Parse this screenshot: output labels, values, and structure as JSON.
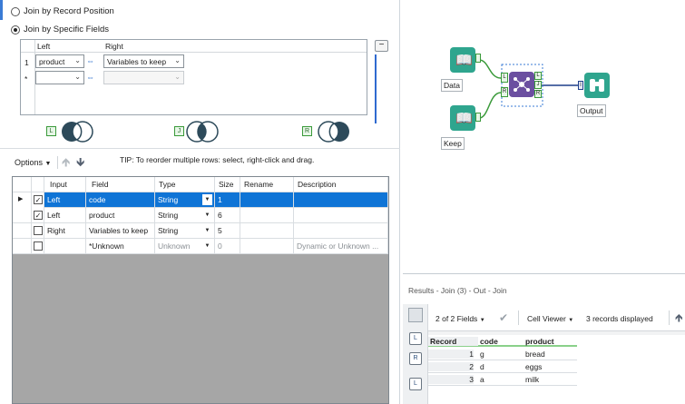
{
  "join_config": {
    "option_record_position": "Join by Record Position",
    "option_specific_fields": "Join by Specific Fields",
    "grid": {
      "header_left": "Left",
      "header_right": "Right",
      "row1_num": "1",
      "row1_left": "product",
      "row1_right": "Variables to keep",
      "row2_num": "*"
    },
    "venn": {
      "left": "L",
      "join": "J",
      "right": "R"
    }
  },
  "options_bar": {
    "options_label": "Options",
    "tip": "TIP: To reorder multiple rows: select, right-click and drag."
  },
  "field_table": {
    "headers": [
      "Input",
      "Field",
      "Type",
      "Size",
      "Rename",
      "Description"
    ],
    "rows": [
      {
        "checked": true,
        "input": "Left",
        "field": "code",
        "type": "String",
        "size": "1",
        "rename": "",
        "description": ""
      },
      {
        "checked": true,
        "input": "Left",
        "field": "product",
        "type": "String",
        "size": "6",
        "rename": "",
        "description": ""
      },
      {
        "checked": false,
        "input": "Right",
        "field": "Variables to keep",
        "type": "String",
        "size": "5",
        "rename": "",
        "description": ""
      },
      {
        "checked": false,
        "input": "",
        "field": "*Unknown",
        "type": "Unknown",
        "size": "0",
        "rename": "",
        "description": "Dynamic or Unknown ..."
      }
    ]
  },
  "canvas": {
    "tools": {
      "data_label": "Data",
      "keep_label": "Keep",
      "output_label": "Output",
      "join_anchors": [
        "L",
        "J",
        "R"
      ],
      "input_anchor_l": "L",
      "input_anchor_r": "R",
      "browse_anchor": "I"
    }
  },
  "results": {
    "title": "Results - Join (3) - Out - Join",
    "fields_selector": "2 of 2 Fields",
    "viewer": "Cell Viewer",
    "records_text": "3 records displayed",
    "side_buttons": [
      "L",
      "R",
      "L"
    ],
    "headers": [
      "Record",
      "code",
      "product"
    ],
    "rows": [
      {
        "record": "1",
        "code": "g",
        "product": "bread"
      },
      {
        "record": "2",
        "code": "d",
        "product": "eggs"
      },
      {
        "record": "3",
        "code": "a",
        "product": "milk"
      }
    ]
  },
  "colors": {
    "accent": "#0f74d6",
    "tool_green": "#2fa58e",
    "join_purple": "#6b4fa0",
    "connector_green": "#3a9a3a"
  }
}
